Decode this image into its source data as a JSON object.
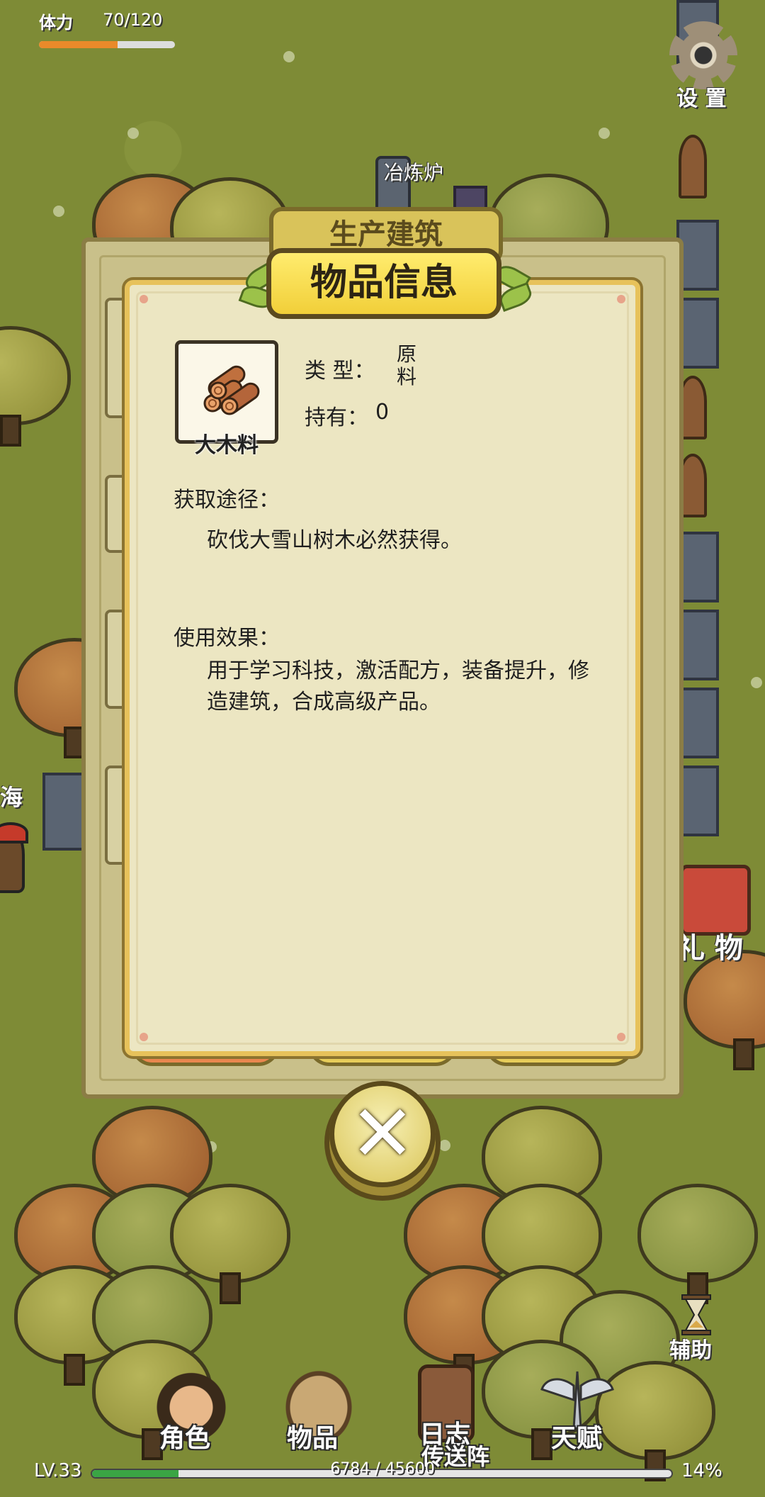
{
  "hud": {
    "stamina_label": "体力",
    "stamina_value": "70/120",
    "stamina_fraction": 0.58,
    "settings_label": "设 置"
  },
  "world": {
    "furnace_label": "冶炼炉",
    "sea_label": "海",
    "gift_label": "礼 物",
    "assist_label": "辅助",
    "teleport_label": "传送阵"
  },
  "back_panel": {
    "title": "生产建筑"
  },
  "item_info": {
    "title": "物品信息",
    "item_name": "大木料",
    "item_icon": "wood-logs-icon",
    "type_label": "类 型：",
    "type_value": "原料",
    "own_label": "持有：",
    "own_value": "0",
    "source_title": "获取途径：",
    "source_text": "砍伐大雪山树木必然获得。",
    "effect_title": "使用效果：",
    "effect_text": "用于学习科技，激活配方，装备提升，修造建筑，合成高级产品。"
  },
  "nav": {
    "items": [
      {
        "label": "角色",
        "icon": "character-icon"
      },
      {
        "label": "物品",
        "icon": "backpack-icon"
      },
      {
        "label": "日志",
        "icon": "journal-icon"
      },
      {
        "label": "天赋",
        "icon": "talent-wings-icon"
      }
    ]
  },
  "progress": {
    "level": "LV.33",
    "xp_text": "6784 / 45600",
    "xp_fraction": 0.149,
    "percent": "14%"
  },
  "colors": {
    "ground": "#7e8b36",
    "panel_border": "#e7c25b",
    "panel_bg": "#ece6c2",
    "stamina_fill": "#e98a2a",
    "xp_fill": "#3aa544"
  }
}
